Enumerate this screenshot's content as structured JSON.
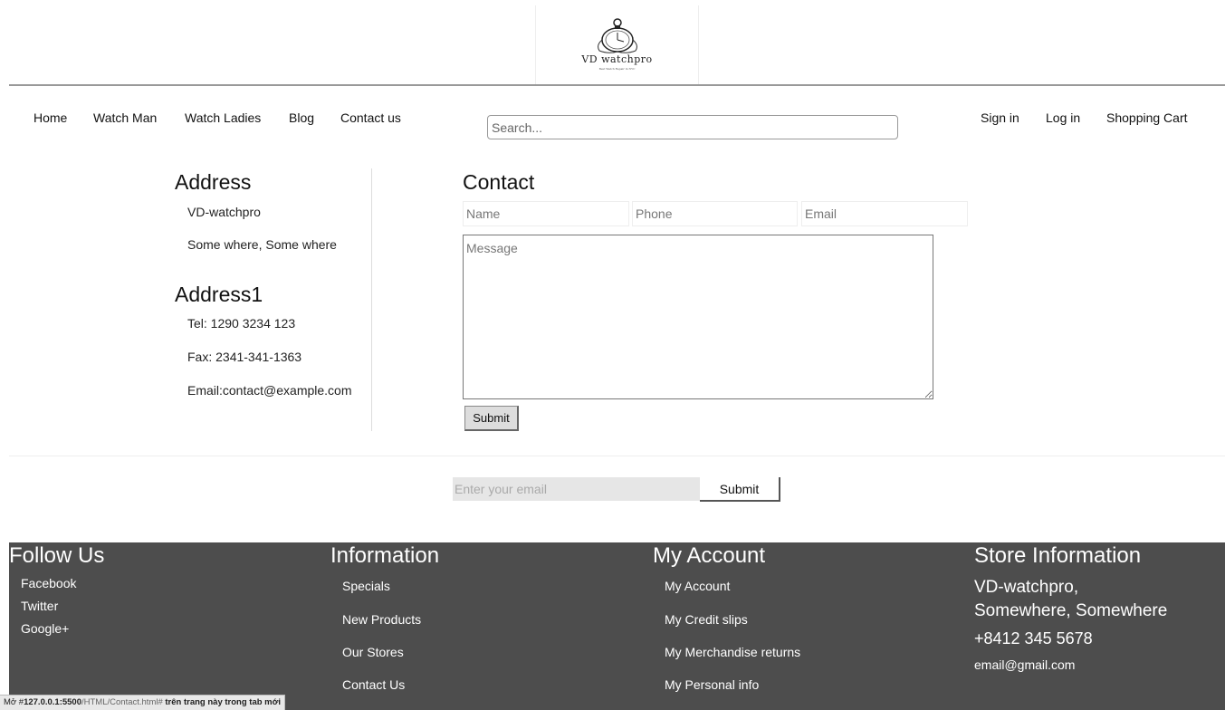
{
  "brand": {
    "name": "VD watchpro",
    "tagline": "Best Watch Repair in NYC"
  },
  "nav": {
    "left": [
      "Home",
      "Watch Man",
      "Watch Ladies",
      "Blog",
      "Contact us"
    ],
    "search_placeholder": "Search...",
    "right": [
      "Sign in",
      "Log in",
      "Shopping Cart"
    ]
  },
  "address": {
    "title": "Address",
    "lines": [
      "VD-watchpro",
      "Some where, Some where"
    ],
    "title2": "Address1",
    "lines2": [
      "Tel: 1290 3234 123",
      "Fax: 2341-341-1363",
      "Email:contact@example.com"
    ]
  },
  "contact": {
    "title": "Contact",
    "name_placeholder": "Name",
    "phone_placeholder": "Phone",
    "email_placeholder": "Email",
    "message_placeholder": "Message",
    "submit_label": "Submit"
  },
  "newsletter": {
    "placeholder": "Enter your email",
    "submit_label": "Submit"
  },
  "footer": {
    "follow": {
      "title": "Follow Us",
      "links": [
        "Facebook",
        "Twitter",
        "Google+"
      ]
    },
    "information": {
      "title": "Information",
      "links": [
        "Specials",
        "New Products",
        "Our Stores",
        "Contact Us"
      ]
    },
    "account": {
      "title": "My Account",
      "links": [
        "My Account",
        "My Credit slips",
        "My Merchandise returns",
        "My Personal info"
      ]
    },
    "store": {
      "title": "Store Information",
      "line1": "VD-watchpro,",
      "line2": "Somewhere, Somewhere",
      "phone": "+8412 345 5678",
      "email": "email@gmail.com"
    }
  },
  "statusbar": {
    "prefix": "Mở #",
    "host": "127.0.0.1:5500",
    "path": "/HTML/Contact.html#",
    "suffix": " trên trang này trong tab mới"
  },
  "colors": {
    "footer_bg": "#4d4d4d",
    "footer_text": "#ffffff"
  }
}
